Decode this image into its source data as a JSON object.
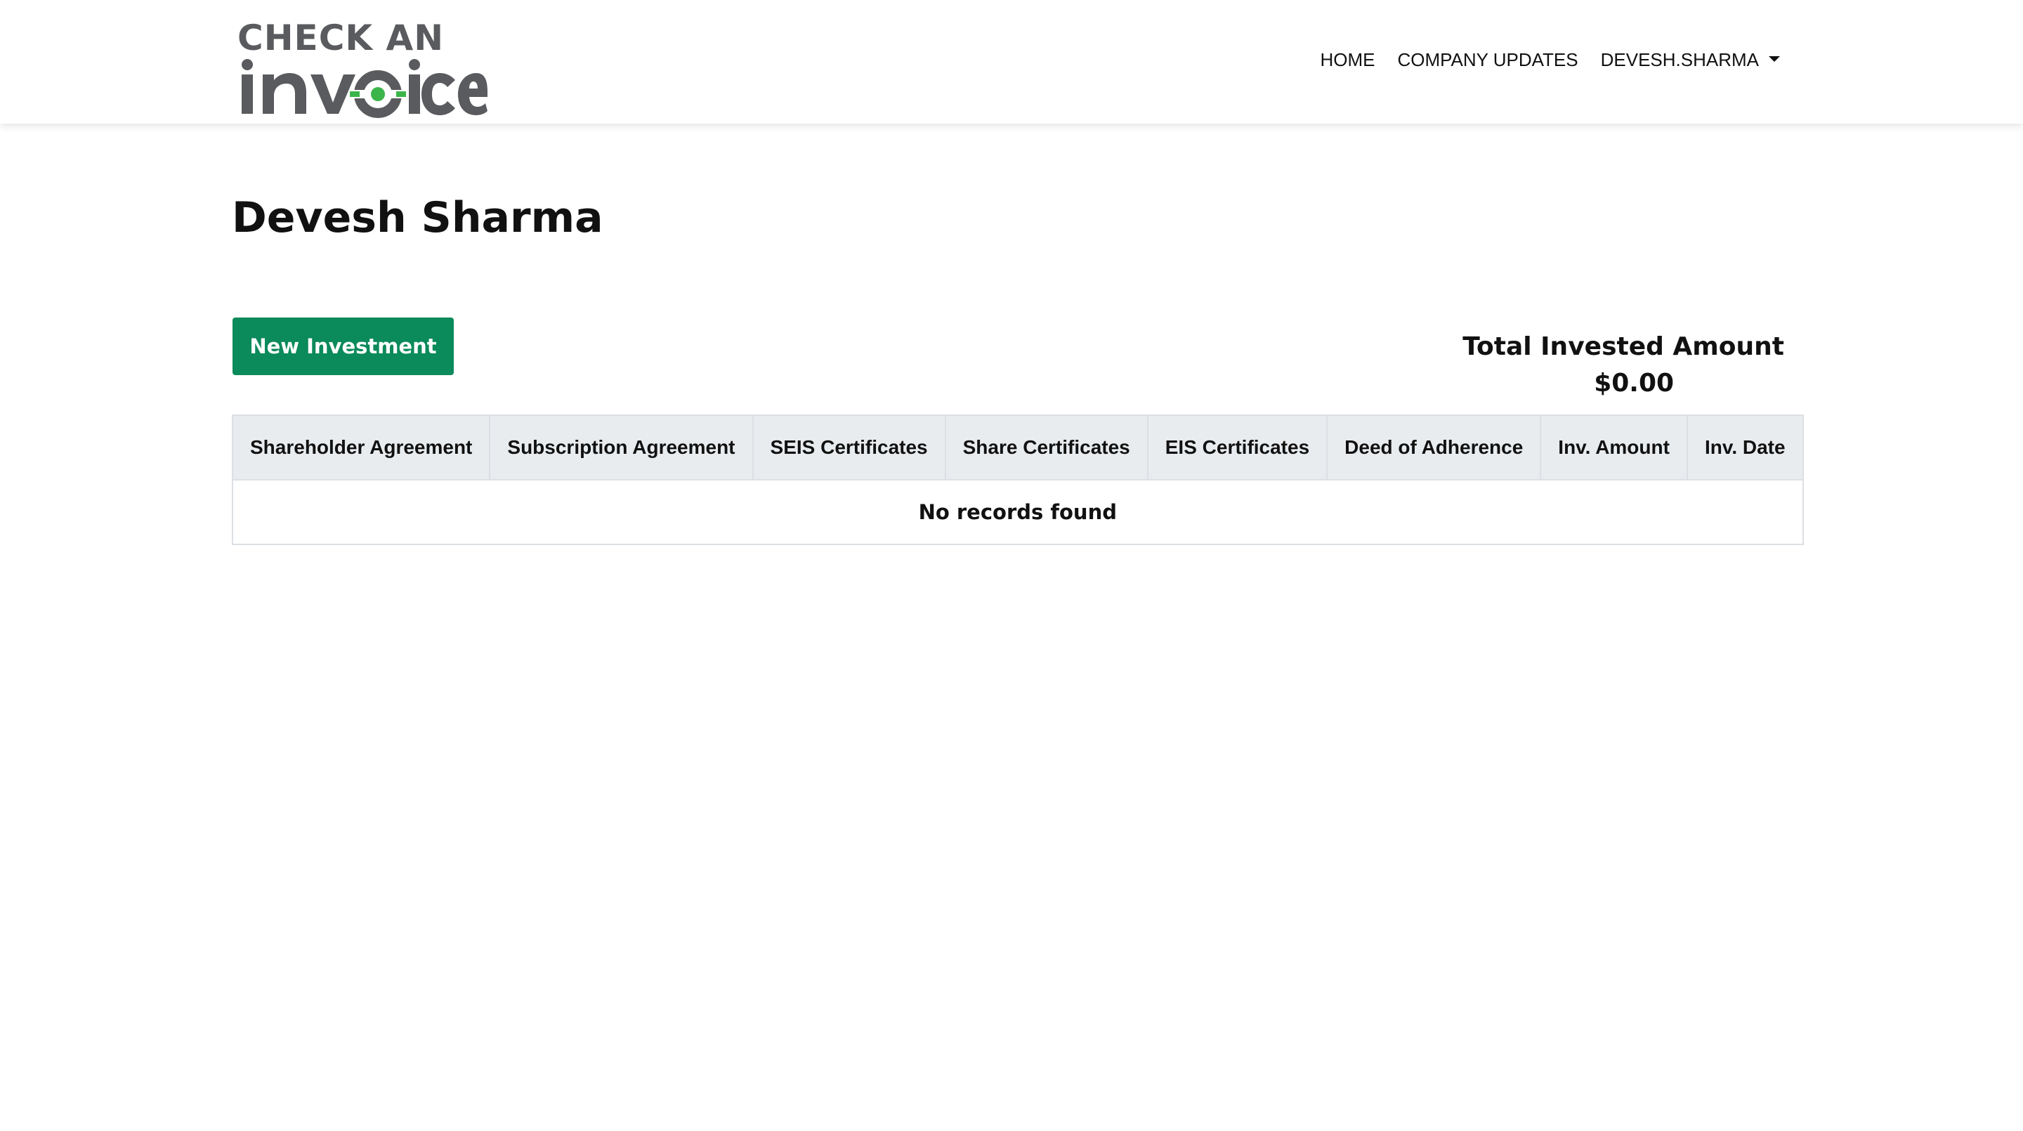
{
  "brand": {
    "logo_top": "CHECK AN",
    "logo_bottom": "invoice",
    "gray": "#5a5b5e",
    "green": "#3bb54a"
  },
  "nav": {
    "home": "HOME",
    "company_updates": "COMPANY UPDATES",
    "user": "DEVESH.SHARMA",
    "user_icon": "caret-down-icon"
  },
  "main": {
    "title": "Devesh Sharma",
    "new_investment_label": "New Investment",
    "button_color": "#0b8a5b",
    "total_label": "Total Invested Amount",
    "total_value": "$0.00"
  },
  "table": {
    "columns": [
      "Shareholder Agreement",
      "Subscription Agreement",
      "SEIS Certificates",
      "Share Certificates",
      "EIS Certificates",
      "Deed of Adherence",
      "Inv. Amount",
      "Inv. Date"
    ],
    "empty_message": "No records found"
  }
}
